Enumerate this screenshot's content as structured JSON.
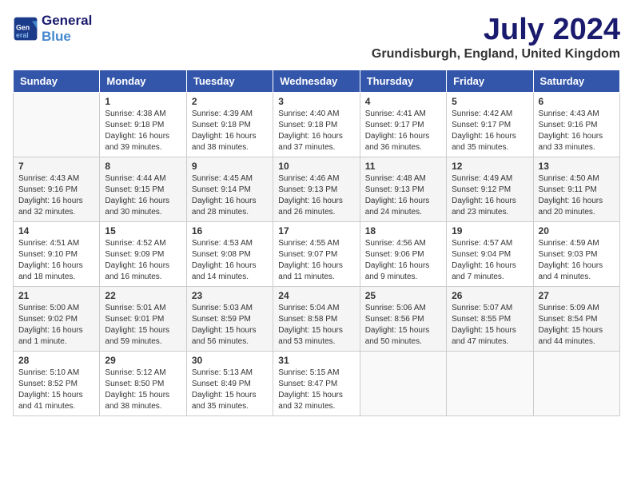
{
  "header": {
    "logo_line1": "General",
    "logo_line2": "Blue",
    "month": "July 2024",
    "location": "Grundisburgh, England, United Kingdom"
  },
  "days_of_week": [
    "Sunday",
    "Monday",
    "Tuesday",
    "Wednesday",
    "Thursday",
    "Friday",
    "Saturday"
  ],
  "weeks": [
    [
      {
        "day": "",
        "empty": true
      },
      {
        "day": "1",
        "sunrise": "Sunrise: 4:38 AM",
        "sunset": "Sunset: 9:18 PM",
        "daylight": "Daylight: 16 hours and 39 minutes."
      },
      {
        "day": "2",
        "sunrise": "Sunrise: 4:39 AM",
        "sunset": "Sunset: 9:18 PM",
        "daylight": "Daylight: 16 hours and 38 minutes."
      },
      {
        "day": "3",
        "sunrise": "Sunrise: 4:40 AM",
        "sunset": "Sunset: 9:18 PM",
        "daylight": "Daylight: 16 hours and 37 minutes."
      },
      {
        "day": "4",
        "sunrise": "Sunrise: 4:41 AM",
        "sunset": "Sunset: 9:17 PM",
        "daylight": "Daylight: 16 hours and 36 minutes."
      },
      {
        "day": "5",
        "sunrise": "Sunrise: 4:42 AM",
        "sunset": "Sunset: 9:17 PM",
        "daylight": "Daylight: 16 hours and 35 minutes."
      },
      {
        "day": "6",
        "sunrise": "Sunrise: 4:43 AM",
        "sunset": "Sunset: 9:16 PM",
        "daylight": "Daylight: 16 hours and 33 minutes."
      }
    ],
    [
      {
        "day": "7",
        "sunrise": "Sunrise: 4:43 AM",
        "sunset": "Sunset: 9:16 PM",
        "daylight": "Daylight: 16 hours and 32 minutes."
      },
      {
        "day": "8",
        "sunrise": "Sunrise: 4:44 AM",
        "sunset": "Sunset: 9:15 PM",
        "daylight": "Daylight: 16 hours and 30 minutes."
      },
      {
        "day": "9",
        "sunrise": "Sunrise: 4:45 AM",
        "sunset": "Sunset: 9:14 PM",
        "daylight": "Daylight: 16 hours and 28 minutes."
      },
      {
        "day": "10",
        "sunrise": "Sunrise: 4:46 AM",
        "sunset": "Sunset: 9:13 PM",
        "daylight": "Daylight: 16 hours and 26 minutes."
      },
      {
        "day": "11",
        "sunrise": "Sunrise: 4:48 AM",
        "sunset": "Sunset: 9:13 PM",
        "daylight": "Daylight: 16 hours and 24 minutes."
      },
      {
        "day": "12",
        "sunrise": "Sunrise: 4:49 AM",
        "sunset": "Sunset: 9:12 PM",
        "daylight": "Daylight: 16 hours and 23 minutes."
      },
      {
        "day": "13",
        "sunrise": "Sunrise: 4:50 AM",
        "sunset": "Sunset: 9:11 PM",
        "daylight": "Daylight: 16 hours and 20 minutes."
      }
    ],
    [
      {
        "day": "14",
        "sunrise": "Sunrise: 4:51 AM",
        "sunset": "Sunset: 9:10 PM",
        "daylight": "Daylight: 16 hours and 18 minutes."
      },
      {
        "day": "15",
        "sunrise": "Sunrise: 4:52 AM",
        "sunset": "Sunset: 9:09 PM",
        "daylight": "Daylight: 16 hours and 16 minutes."
      },
      {
        "day": "16",
        "sunrise": "Sunrise: 4:53 AM",
        "sunset": "Sunset: 9:08 PM",
        "daylight": "Daylight: 16 hours and 14 minutes."
      },
      {
        "day": "17",
        "sunrise": "Sunrise: 4:55 AM",
        "sunset": "Sunset: 9:07 PM",
        "daylight": "Daylight: 16 hours and 11 minutes."
      },
      {
        "day": "18",
        "sunrise": "Sunrise: 4:56 AM",
        "sunset": "Sunset: 9:06 PM",
        "daylight": "Daylight: 16 hours and 9 minutes."
      },
      {
        "day": "19",
        "sunrise": "Sunrise: 4:57 AM",
        "sunset": "Sunset: 9:04 PM",
        "daylight": "Daylight: 16 hours and 7 minutes."
      },
      {
        "day": "20",
        "sunrise": "Sunrise: 4:59 AM",
        "sunset": "Sunset: 9:03 PM",
        "daylight": "Daylight: 16 hours and 4 minutes."
      }
    ],
    [
      {
        "day": "21",
        "sunrise": "Sunrise: 5:00 AM",
        "sunset": "Sunset: 9:02 PM",
        "daylight": "Daylight: 16 hours and 1 minute."
      },
      {
        "day": "22",
        "sunrise": "Sunrise: 5:01 AM",
        "sunset": "Sunset: 9:01 PM",
        "daylight": "Daylight: 15 hours and 59 minutes."
      },
      {
        "day": "23",
        "sunrise": "Sunrise: 5:03 AM",
        "sunset": "Sunset: 8:59 PM",
        "daylight": "Daylight: 15 hours and 56 minutes."
      },
      {
        "day": "24",
        "sunrise": "Sunrise: 5:04 AM",
        "sunset": "Sunset: 8:58 PM",
        "daylight": "Daylight: 15 hours and 53 minutes."
      },
      {
        "day": "25",
        "sunrise": "Sunrise: 5:06 AM",
        "sunset": "Sunset: 8:56 PM",
        "daylight": "Daylight: 15 hours and 50 minutes."
      },
      {
        "day": "26",
        "sunrise": "Sunrise: 5:07 AM",
        "sunset": "Sunset: 8:55 PM",
        "daylight": "Daylight: 15 hours and 47 minutes."
      },
      {
        "day": "27",
        "sunrise": "Sunrise: 5:09 AM",
        "sunset": "Sunset: 8:54 PM",
        "daylight": "Daylight: 15 hours and 44 minutes."
      }
    ],
    [
      {
        "day": "28",
        "sunrise": "Sunrise: 5:10 AM",
        "sunset": "Sunset: 8:52 PM",
        "daylight": "Daylight: 15 hours and 41 minutes."
      },
      {
        "day": "29",
        "sunrise": "Sunrise: 5:12 AM",
        "sunset": "Sunset: 8:50 PM",
        "daylight": "Daylight: 15 hours and 38 minutes."
      },
      {
        "day": "30",
        "sunrise": "Sunrise: 5:13 AM",
        "sunset": "Sunset: 8:49 PM",
        "daylight": "Daylight: 15 hours and 35 minutes."
      },
      {
        "day": "31",
        "sunrise": "Sunrise: 5:15 AM",
        "sunset": "Sunset: 8:47 PM",
        "daylight": "Daylight: 15 hours and 32 minutes."
      },
      {
        "day": "",
        "empty": true
      },
      {
        "day": "",
        "empty": true
      },
      {
        "day": "",
        "empty": true
      }
    ]
  ]
}
